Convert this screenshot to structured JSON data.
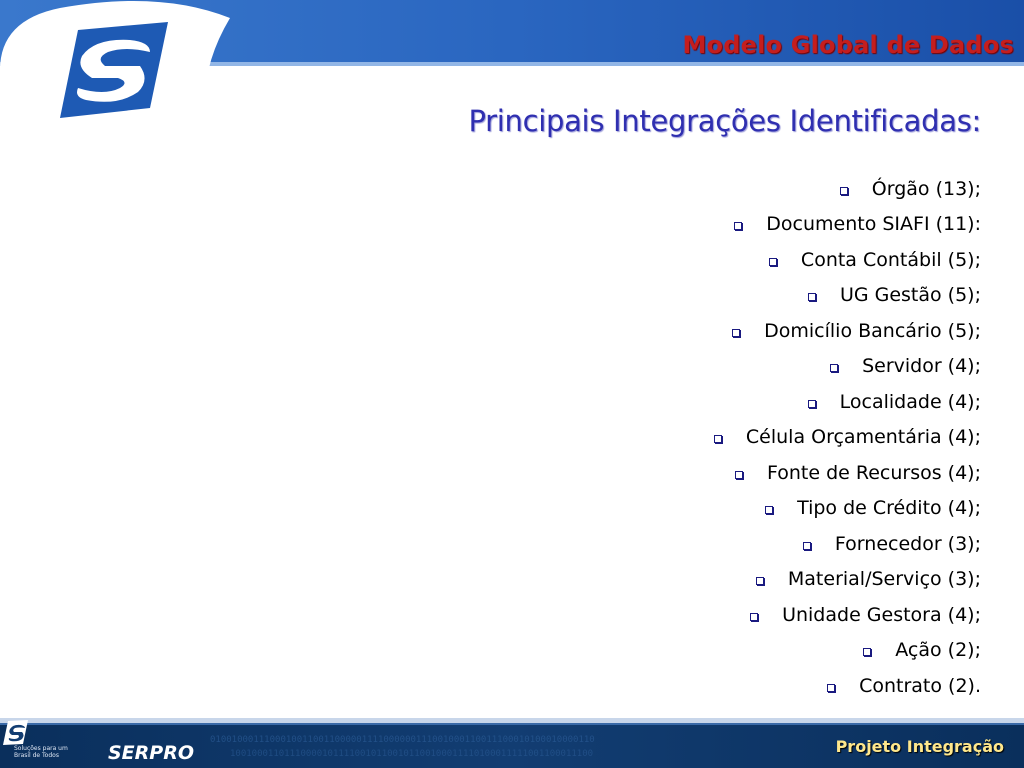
{
  "header": {
    "title": "Modelo Global de Dados"
  },
  "slide": {
    "title": "Principais Integrações Identificadas:",
    "items": [
      "Órgão (13);",
      "Documento SIAFI (11):",
      "Conta Contábil (5);",
      "UG Gestão (5);",
      "Domicílio Bancário (5);",
      "Servidor (4);",
      "Localidade (4);",
      "Célula Orçamentária (4);",
      "Fonte de Recursos (4);",
      "Tipo de Crédito (4);",
      "Fornecedor (3);",
      "Material/Serviço (3);",
      "Unidade Gestora (4);",
      "Ação (2);",
      "Contrato (2)."
    ]
  },
  "footer": {
    "tagline": "Soluções para um\nBrasil de Todos",
    "brand": "SERPRO",
    "project": "Projeto Integração"
  },
  "icons": {
    "bullet": "hollow-square-icon",
    "logo": "serpro-s-logo-icon"
  },
  "colors": {
    "header_blue": "#1e5ab4",
    "title_red": "#c41e1e",
    "title_blue": "#2f2fb0",
    "footer_dark": "#06264a",
    "footer_text": "#ffe88c"
  }
}
